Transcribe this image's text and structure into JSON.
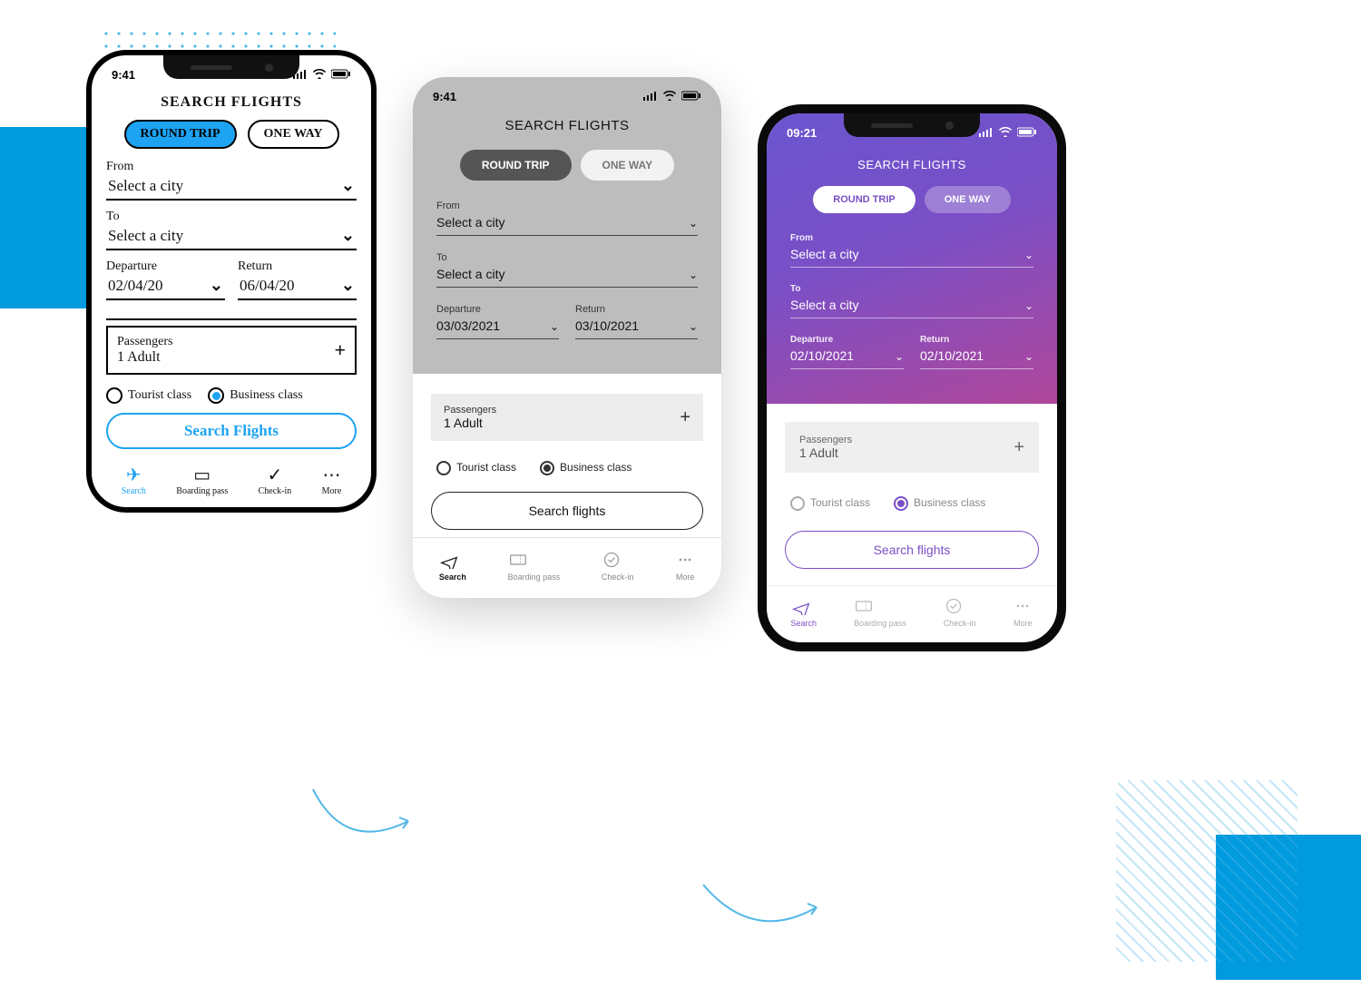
{
  "sketch": {
    "time": "9:41",
    "title": "SEARCH FLIGHTS",
    "trip_round": "ROUND TRIP",
    "trip_oneway": "ONE WAY",
    "from_label": "From",
    "from_value": "Select a city",
    "to_label": "To",
    "to_value": "Select a city",
    "dep_label": "Departure",
    "dep_value": "02/04/20",
    "ret_label": "Return",
    "ret_value": "06/04/20",
    "passengers_label": "Passengers",
    "passengers_value": "1 Adult",
    "class_tourist": "Tourist class",
    "class_business": "Business class",
    "search_btn": "Search Flights",
    "nav": {
      "search": "Search",
      "boarding": "Boarding pass",
      "checkin": "Check-in",
      "more": "More"
    }
  },
  "wire": {
    "time": "9:41",
    "title": "SEARCH FLIGHTS",
    "trip_round": "ROUND TRIP",
    "trip_oneway": "ONE WAY",
    "from_label": "From",
    "from_value": "Select a city",
    "to_label": "To",
    "to_value": "Select a city",
    "dep_label": "Departure",
    "dep_value": "03/03/2021",
    "ret_label": "Return",
    "ret_value": "03/10/2021",
    "passengers_label": "Passengers",
    "passengers_value": "1 Adult",
    "class_tourist": "Tourist class",
    "class_business": "Business class",
    "search_btn": "Search flights",
    "nav": {
      "search": "Search",
      "boarding": "Boarding pass",
      "checkin": "Check-in",
      "more": "More"
    }
  },
  "hifi": {
    "time": "09:21",
    "title": "SEARCH FLIGHTS",
    "trip_round": "ROUND TRIP",
    "trip_oneway": "ONE WAY",
    "from_label": "From",
    "from_value": "Select a city",
    "to_label": "To",
    "to_value": "Select a city",
    "dep_label": "Departure",
    "dep_value": "02/10/2021",
    "ret_label": "Return",
    "ret_value": "02/10/2021",
    "passengers_label": "Passengers",
    "passengers_value": "1 Adult",
    "class_tourist": "Tourist class",
    "class_business": "Business class",
    "search_btn": "Search flights",
    "nav": {
      "search": "Search",
      "boarding": "Boarding pass",
      "checkin": "Check-in",
      "more": "More"
    }
  }
}
